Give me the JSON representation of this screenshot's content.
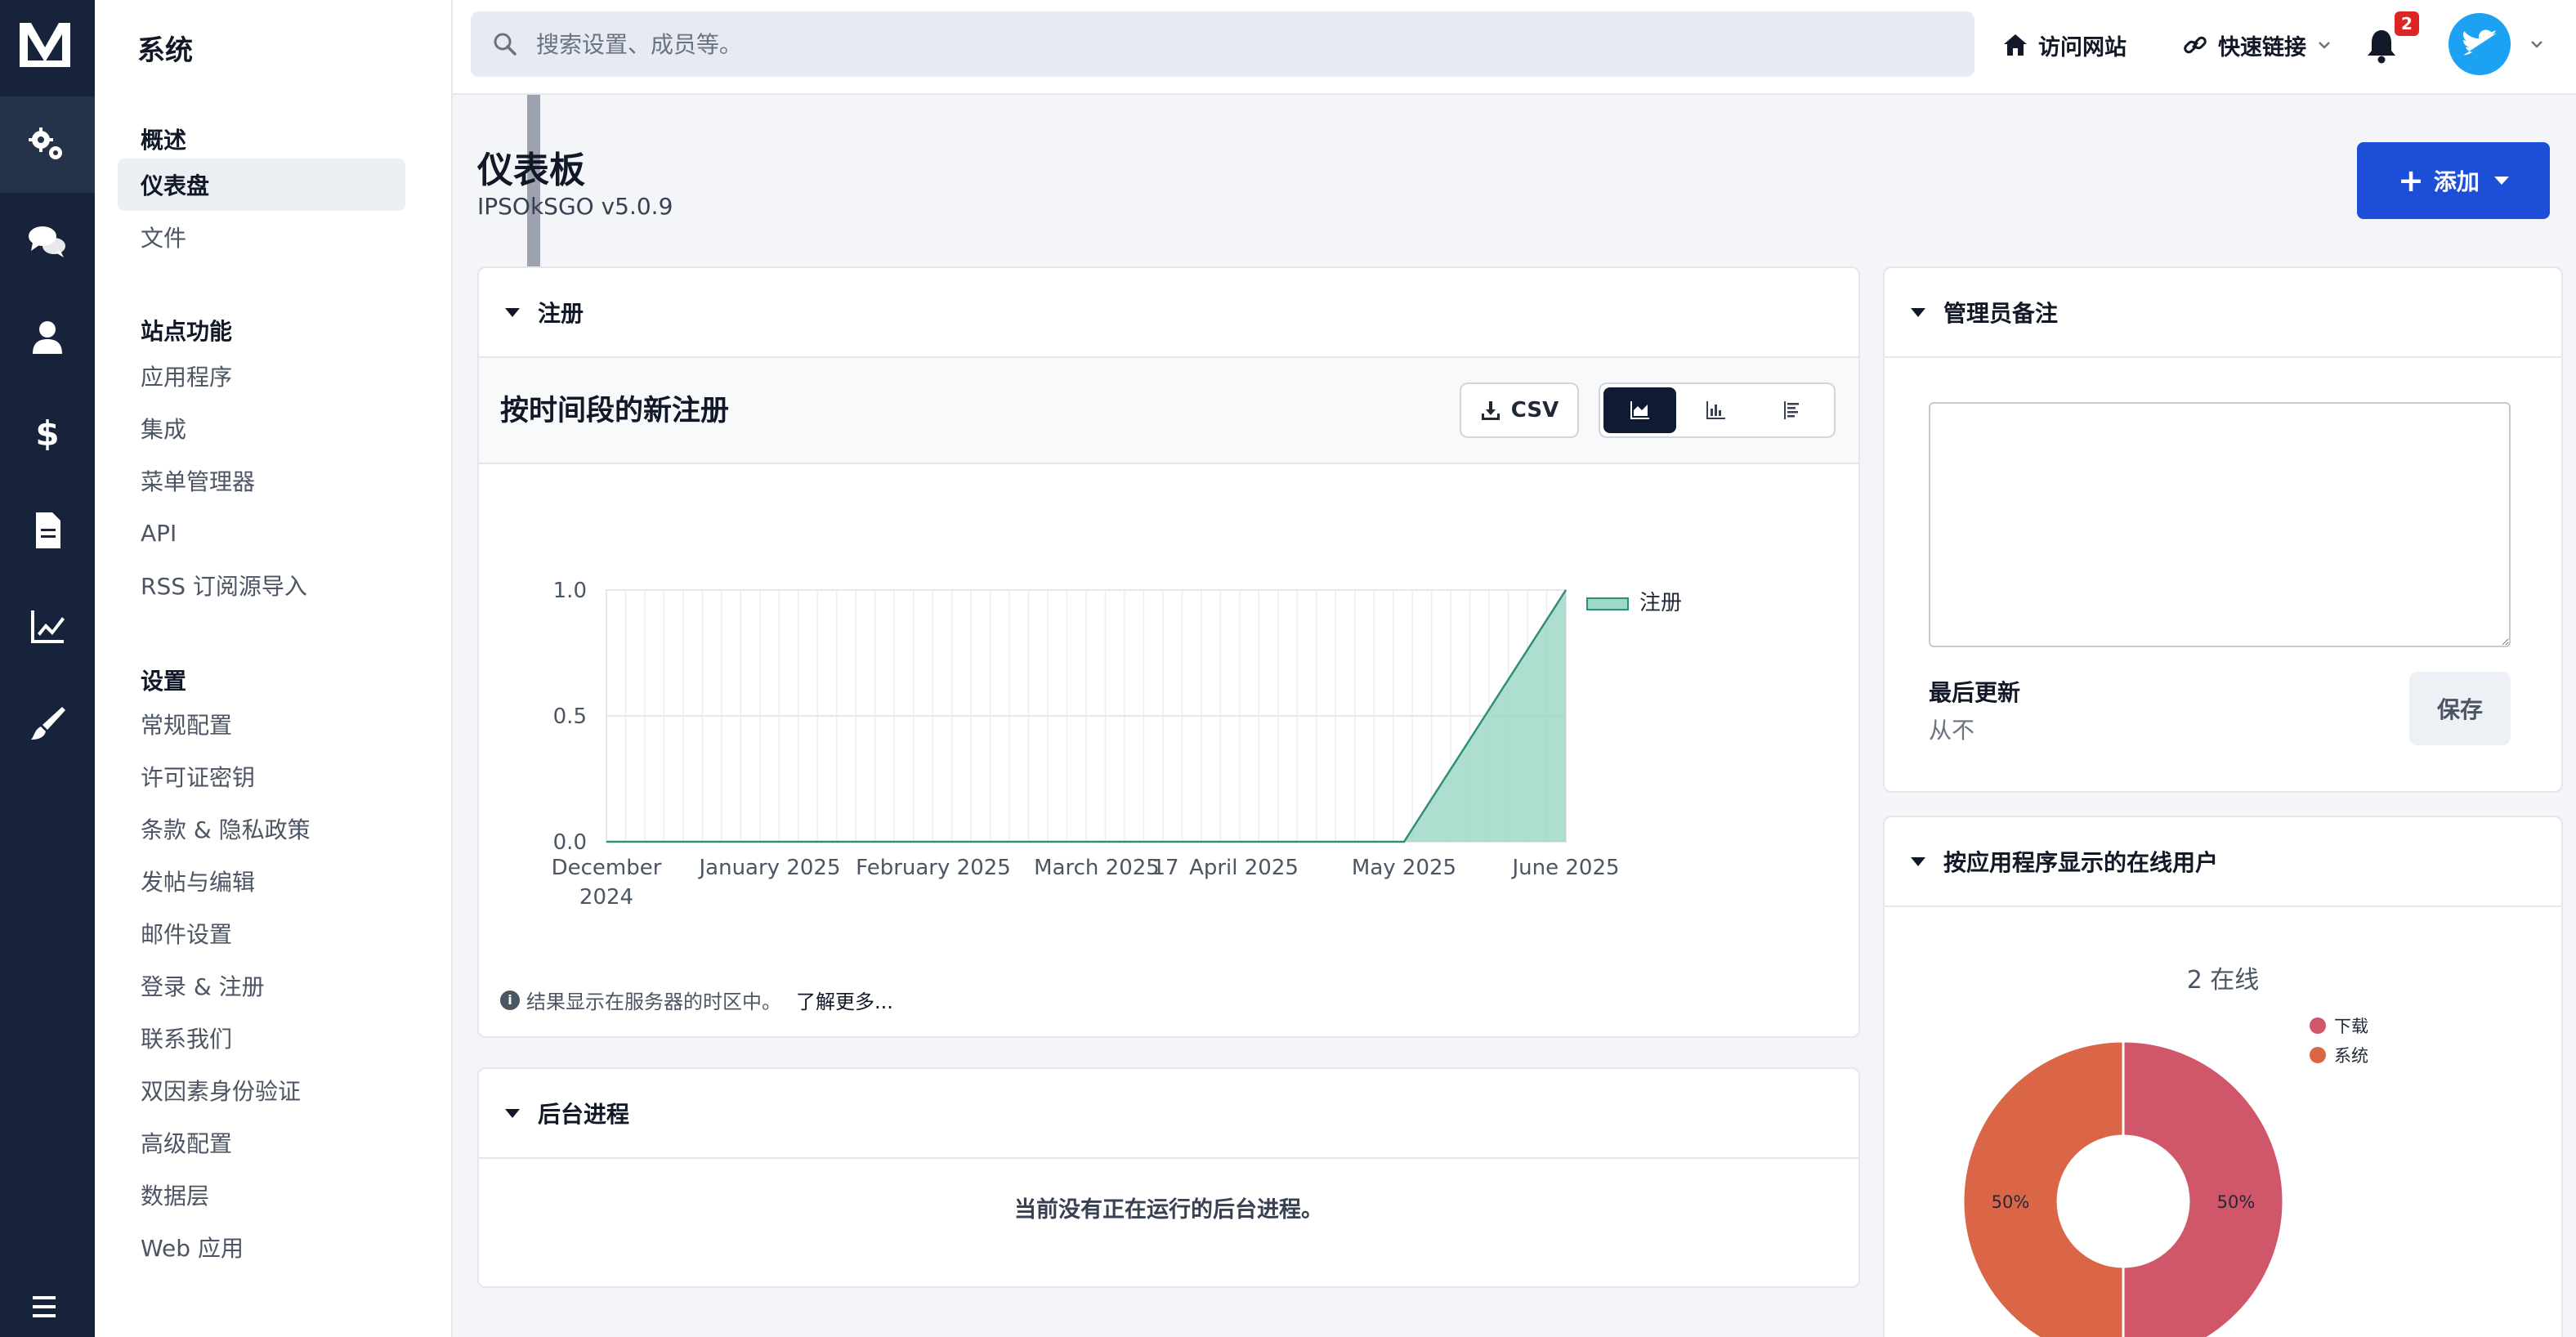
{
  "app": {
    "title": "系统"
  },
  "sidebar": {
    "sections": [
      {
        "title": "概述",
        "items": [
          {
            "label": "仪表盘",
            "active": true
          },
          {
            "label": "文件"
          }
        ]
      },
      {
        "title": "站点功能",
        "items": [
          {
            "label": "应用程序"
          },
          {
            "label": "集成"
          },
          {
            "label": "菜单管理器"
          },
          {
            "label": "API"
          },
          {
            "label": "RSS 订阅源导入"
          }
        ]
      },
      {
        "title": "设置",
        "items": [
          {
            "label": "常规配置"
          },
          {
            "label": "许可证密钥"
          },
          {
            "label": "条款 & 隐私政策"
          },
          {
            "label": "发帖与编辑"
          },
          {
            "label": "邮件设置"
          },
          {
            "label": "登录 & 注册"
          },
          {
            "label": "联系我们"
          },
          {
            "label": "双因素身份验证"
          },
          {
            "label": "高级配置"
          },
          {
            "label": "数据层"
          },
          {
            "label": "Web 应用"
          }
        ]
      }
    ]
  },
  "rail": {
    "icons": [
      "gears-icon",
      "comments-icon",
      "user-icon",
      "dollar-icon",
      "file-icon",
      "chart-line-icon",
      "brush-icon"
    ]
  },
  "header": {
    "search_placeholder": "搜索设置、成员等。",
    "visit_site": "访问网站",
    "quick_links": "快速链接",
    "notification_count": "2"
  },
  "page": {
    "title": "仪表板",
    "subtitle": "IPSOkSGO v5.0.9",
    "add_button": "添加"
  },
  "registrations": {
    "card_title": "注册",
    "chart_title": "按时间段的新注册",
    "csv_label": "CSV",
    "note": "结果显示在服务器的时区中。",
    "learn_more": "了解更多..."
  },
  "background": {
    "card_title": "后台进程",
    "empty": "当前没有正在运行的后台进程。"
  },
  "admin_notes": {
    "card_title": "管理员备注",
    "last_updated_label": "最后更新",
    "last_updated_value": "从不",
    "save_label": "保存"
  },
  "online_users": {
    "card_title": "按应用程序显示的在线用户",
    "count_label": "2 在线"
  },
  "colors": {
    "rail_bg": "#16233a",
    "accent": "#1d4ed8",
    "area_fill": "#9fd8c8",
    "area_line": "#2f8f77",
    "pie_downloads": "#d0576a",
    "pie_system": "#db6647"
  },
  "chart_data": [
    {
      "type": "area",
      "title": "",
      "xlabel": "",
      "ylabel": "",
      "ylim": [
        0,
        1.0
      ],
      "yticks": [
        "0.0",
        "0.5",
        "1.0"
      ],
      "x": [
        "December 2024",
        "January 2025",
        "February 2025",
        "March 2025",
        "17",
        "April 2025",
        "May 2025",
        "June 2025"
      ],
      "series": [
        {
          "name": "注册",
          "values": [
            0,
            0,
            0,
            0,
            0,
            0,
            0,
            1.0
          ]
        }
      ],
      "legend": "right",
      "grid": true
    },
    {
      "type": "pie",
      "title": "",
      "donut": true,
      "slices": [
        {
          "name": "下载",
          "value": 50,
          "label": "50%"
        },
        {
          "name": "系统",
          "value": 50,
          "label": "50%"
        }
      ],
      "legend": "top-right"
    }
  ]
}
